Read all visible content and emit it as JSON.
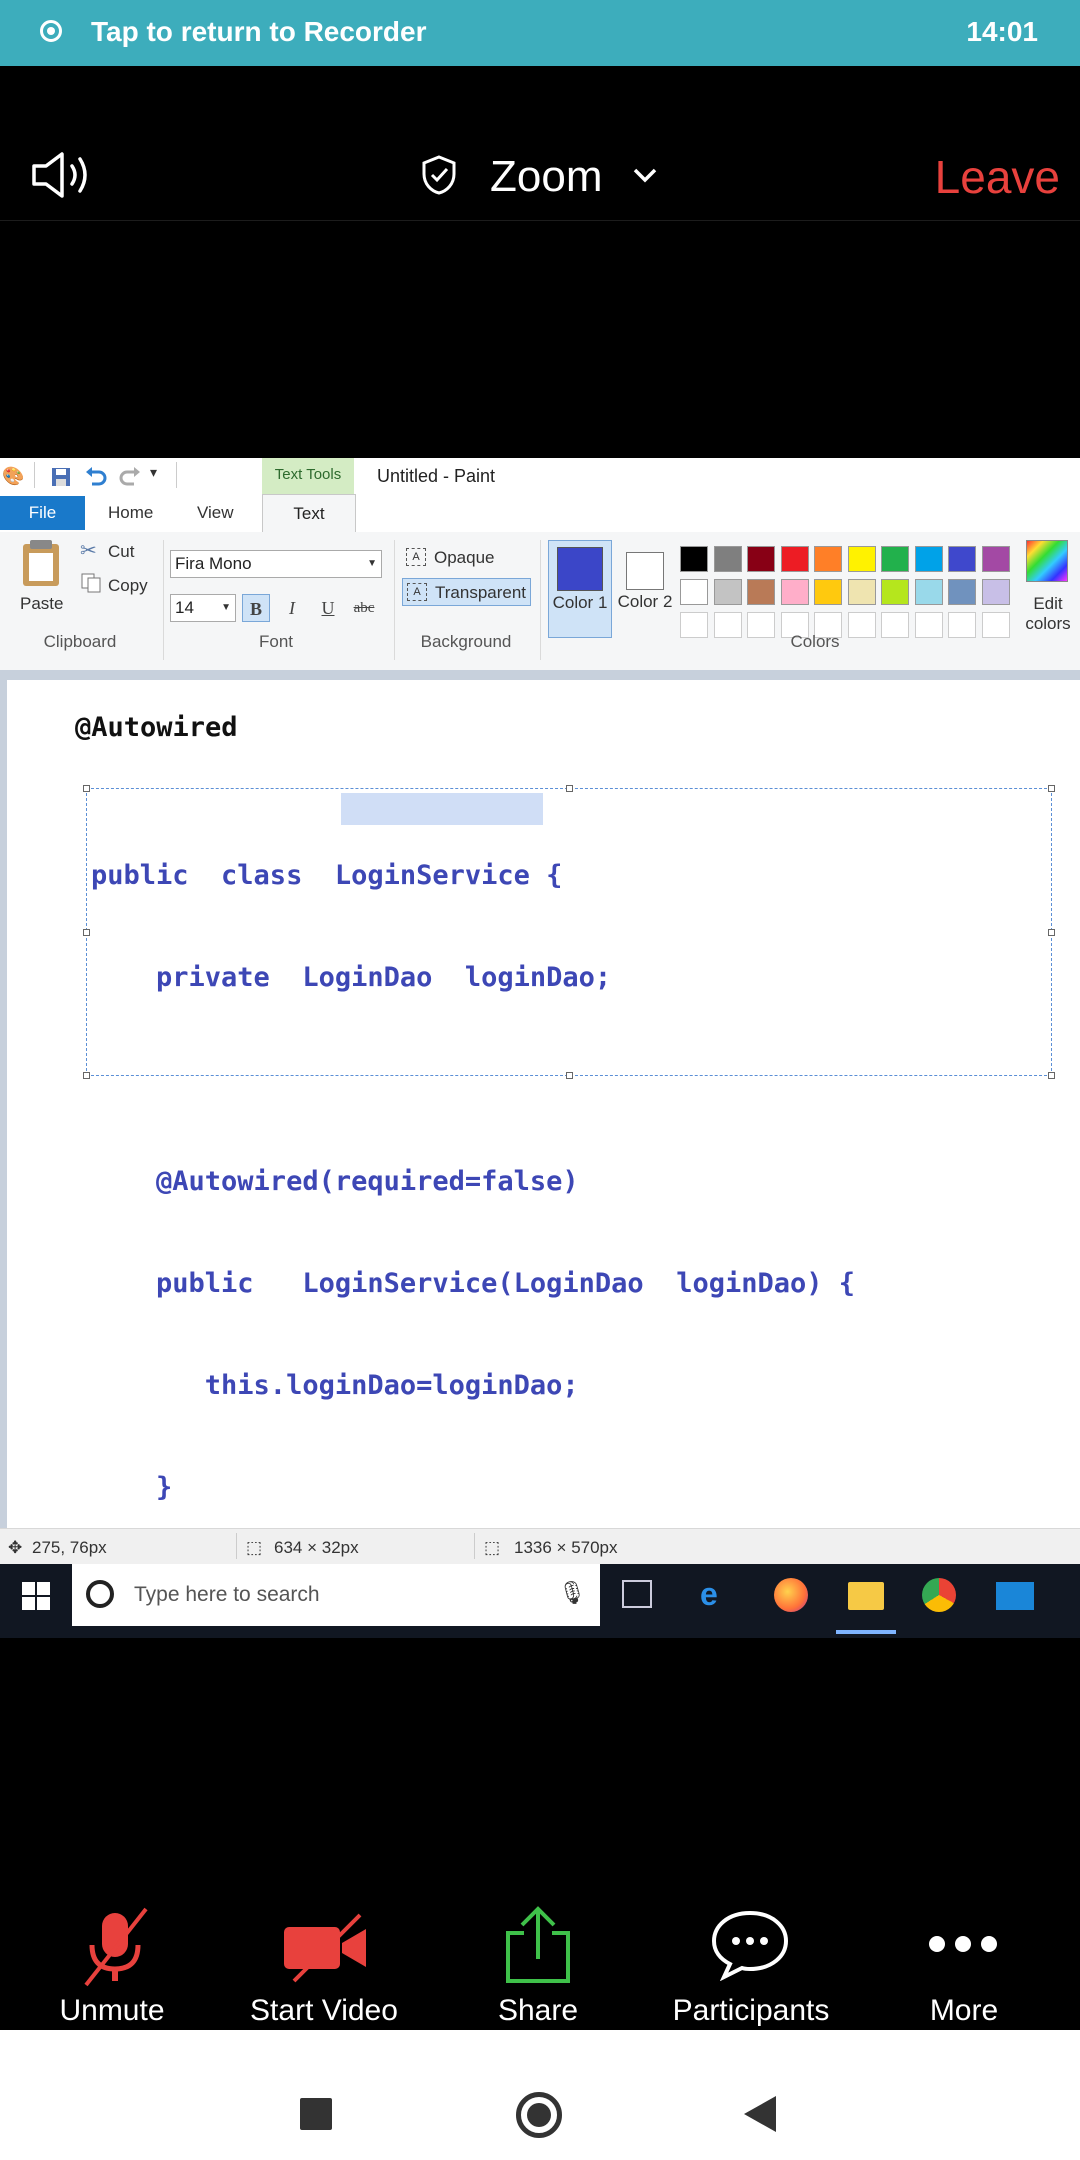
{
  "status_banner": {
    "text": "Tap to return to Recorder",
    "time": "14:01"
  },
  "zoom_header": {
    "title": "Zoom",
    "leave_label": "Leave"
  },
  "paint": {
    "window_title": "Untitled - Paint",
    "contextual_tab": "Text Tools",
    "tabs": {
      "file": "File",
      "home": "Home",
      "view": "View",
      "text": "Text"
    },
    "clipboard": {
      "paste": "Paste",
      "cut": "Cut",
      "copy": "Copy",
      "group_label": "Clipboard"
    },
    "font": {
      "family": "Fira Mono",
      "size": "14",
      "bold": "B",
      "italic": "I",
      "underline": "U",
      "strike": "abc",
      "group_label": "Font"
    },
    "background": {
      "opaque": "Opaque",
      "transparent": "Transparent",
      "group_label": "Background"
    },
    "colors": {
      "color1_label": "Color 1",
      "color2_label": "Color 2",
      "edit_label": "Edit colors",
      "group_label": "Colors",
      "color1": "#3b46c8",
      "color2": "#ffffff",
      "palette_row1": [
        "#000000",
        "#7f7f7f",
        "#880015",
        "#ed1c24",
        "#ff7f27",
        "#fff200",
        "#22b14c",
        "#00a2e8",
        "#3f48cc",
        "#a349a4"
      ],
      "palette_row2": [
        "#ffffff",
        "#c3c3c3",
        "#b97a57",
        "#ffaec9",
        "#ffc90e",
        "#efe4b0",
        "#b5e61d",
        "#99d9ea",
        "#7092be",
        "#c8bfe7"
      ]
    },
    "canvas": {
      "annotation": "@Autowired",
      "code_lines": [
        "public  class  LoginService {",
        "    private  LoginDao  loginDao;",
        "",
        "    @Autowired(required=false)",
        "    public   LoginService(LoginDao  loginDao) {",
        "       this.loginDao=loginDao;",
        "    }",
        "}"
      ]
    },
    "status": {
      "cursor": "275, 76px",
      "selection": "634 × 32px",
      "canvas_size": "1336 × 570px"
    }
  },
  "taskbar": {
    "search_placeholder": "Type here to search"
  },
  "zoom_controls": {
    "unmute": "Unmute",
    "start_video": "Start Video",
    "share": "Share",
    "participants": "Participants",
    "more": "More"
  }
}
